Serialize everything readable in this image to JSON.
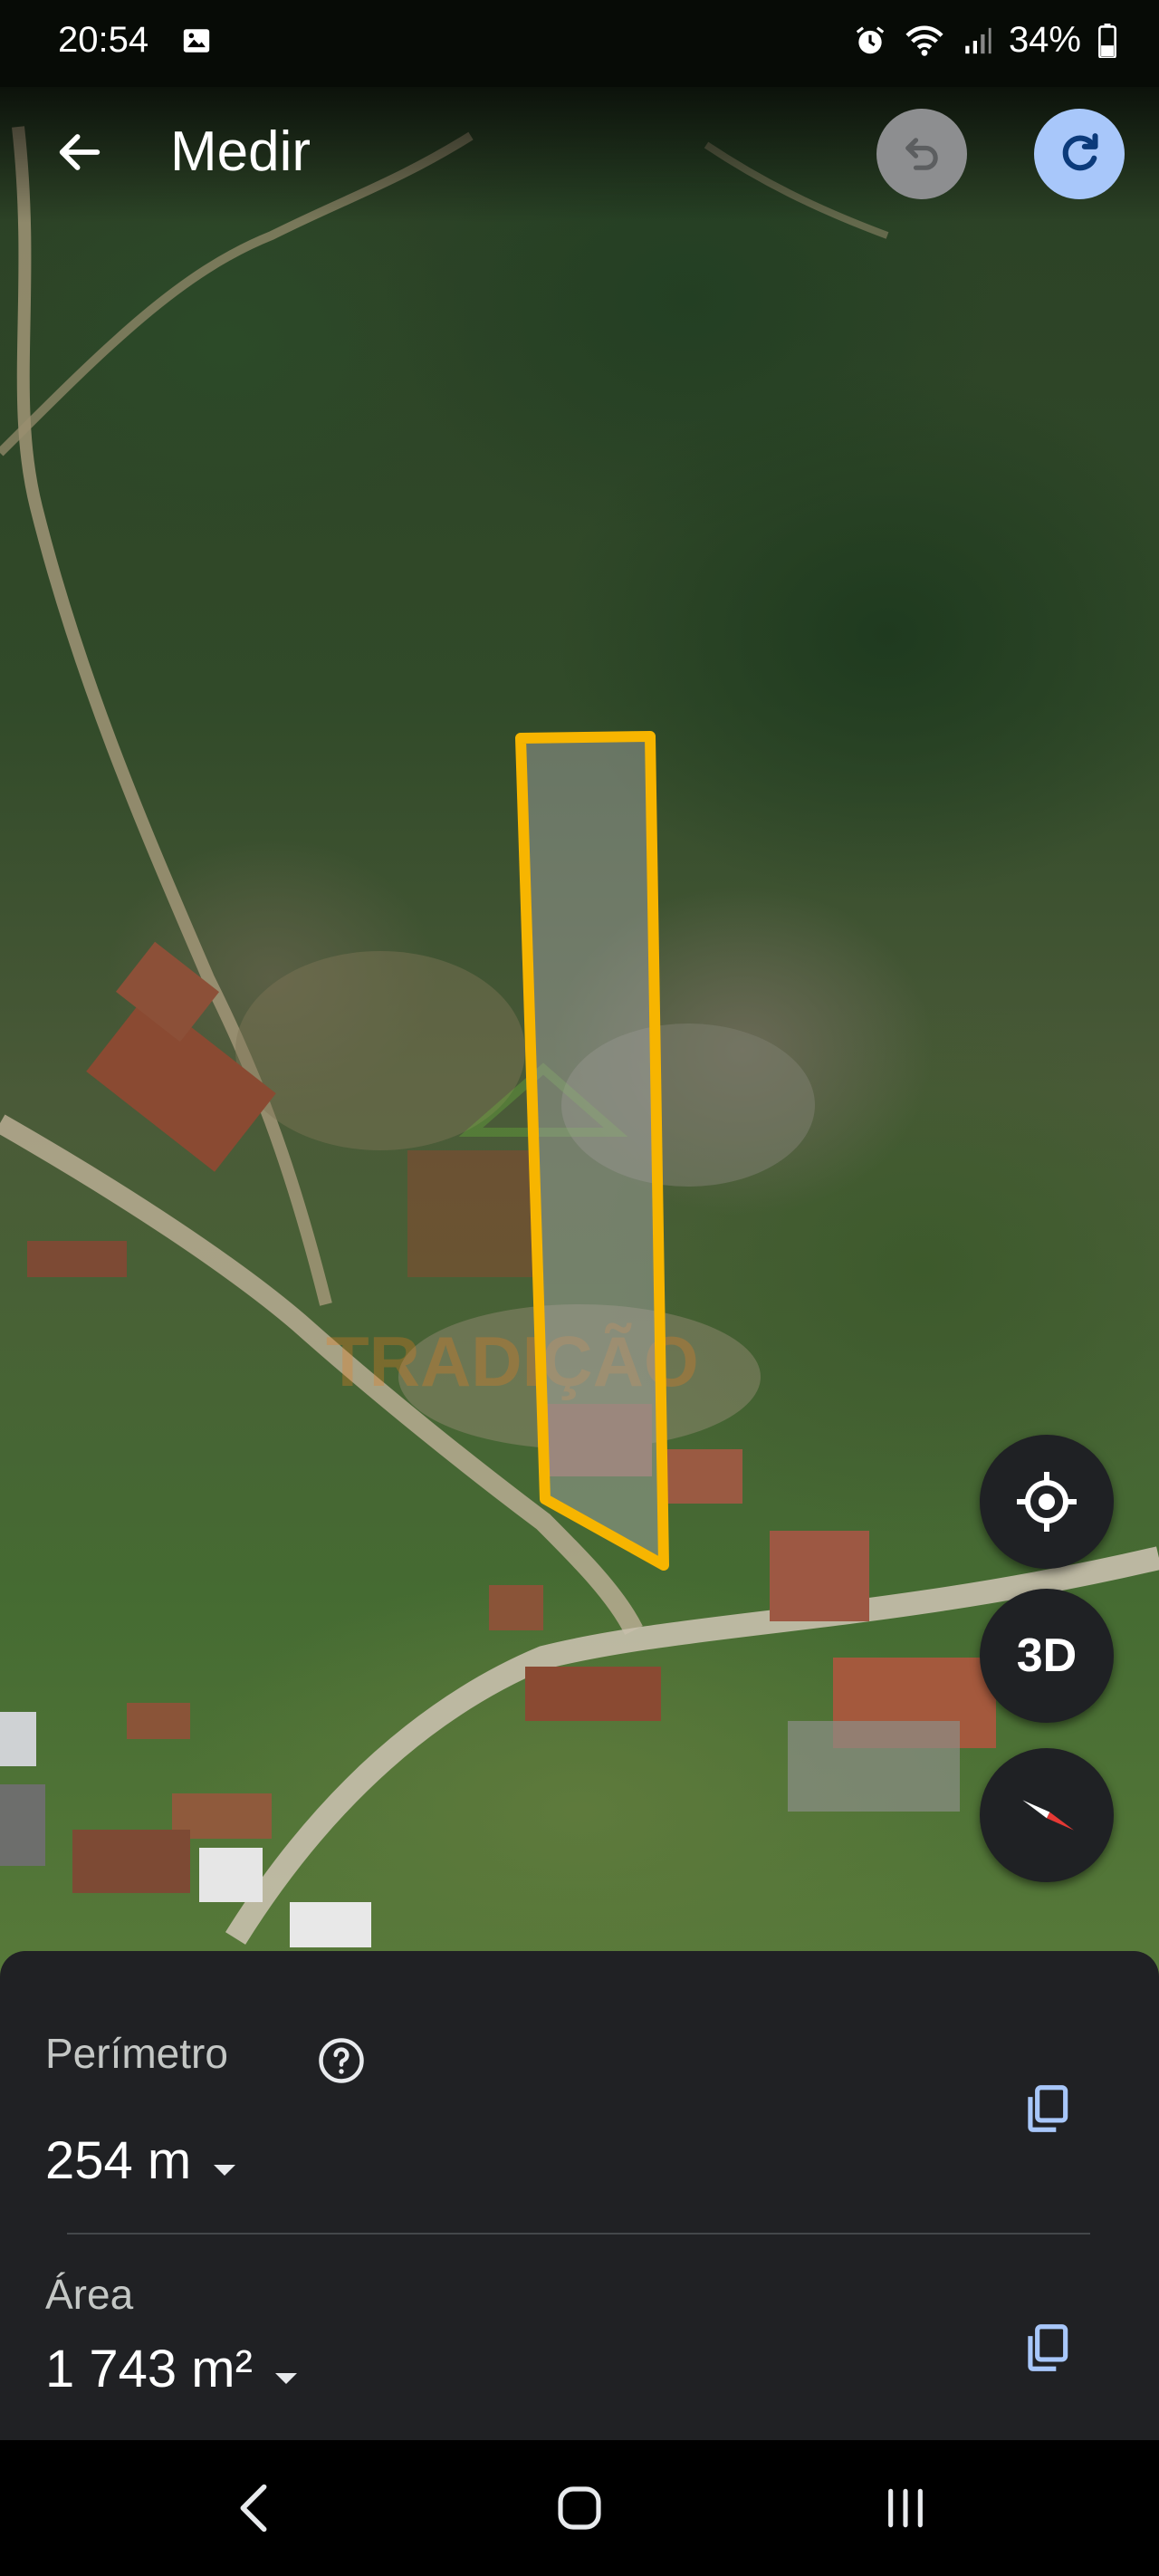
{
  "status_bar": {
    "time": "20:54",
    "battery": "34%",
    "icons": [
      "gallery-icon",
      "alarm-icon",
      "wifi-icon",
      "signal-icon",
      "battery-icon"
    ]
  },
  "app_bar": {
    "title": "Medir",
    "icons": [
      "back-arrow-icon",
      "undo-icon",
      "redo-icon"
    ]
  },
  "map": {
    "watermark": "TRADIÇÃO",
    "measurement_color": "#f7b500",
    "controls": {
      "locate_icon": "my-location-icon",
      "view_3d_label": "3D",
      "compass_icon": "compass-icon"
    }
  },
  "measurements": {
    "perimeter_label": "Perímetro",
    "perimeter_value": "254 m",
    "area_label": "Área",
    "area_value": "1 743 m²",
    "icons": [
      "help-icon",
      "dropdown-caret-icon",
      "copy-icon"
    ]
  },
  "nav_bar": {
    "buttons": [
      "back-icon",
      "home-icon",
      "recents-icon"
    ]
  },
  "colors": {
    "sheet_bg": "#202124",
    "accent_blue": "#a8c7fa",
    "undo_disabled": "#8d8e90"
  }
}
